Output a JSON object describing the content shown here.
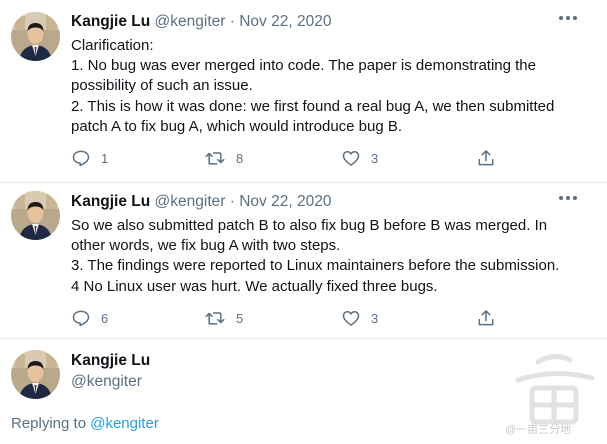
{
  "tweets": [
    {
      "author_name": "Kangjie Lu",
      "author_handle": "@kengiter",
      "separator": "·",
      "date": "Nov 22, 2020",
      "lines": [
        "Clarification:",
        "1. No bug was ever merged into code. The paper is demonstrating the",
        "possibility of such an issue.",
        "2. This is how it was done: we first found a real bug A, we then submitted",
        "patch A to fix bug A, which would introduce bug B."
      ],
      "reply_count": "1",
      "retweet_count": "8",
      "like_count": "3"
    },
    {
      "author_name": "Kangjie Lu",
      "author_handle": "@kengiter",
      "separator": "·",
      "date": "Nov 22, 2020",
      "lines": [
        "So we also submitted patch B to also fix bug B before B was merged. In",
        "other words, we fix bug A with two steps.",
        "3. The findings were reported to Linux maintainers before the submission.",
        "4 No Linux user was hurt. We actually fixed three bugs."
      ],
      "reply_count": "6",
      "retweet_count": "5",
      "like_count": "3"
    }
  ],
  "profile": {
    "name": "Kangjie Lu",
    "handle": "@kengiter"
  },
  "replying": {
    "prefix": "Replying to",
    "mention": "@kengiter"
  },
  "watermark_text": "@一亩三分地",
  "icons": {
    "reply": "reply-icon",
    "retweet": "retweet-icon",
    "like": "like-icon",
    "share": "share-icon",
    "more": "more-icon"
  },
  "colors": {
    "text": "#0f1419",
    "secondary": "#5b7083",
    "link": "#1da1f2",
    "divider": "#e6ecf0"
  }
}
